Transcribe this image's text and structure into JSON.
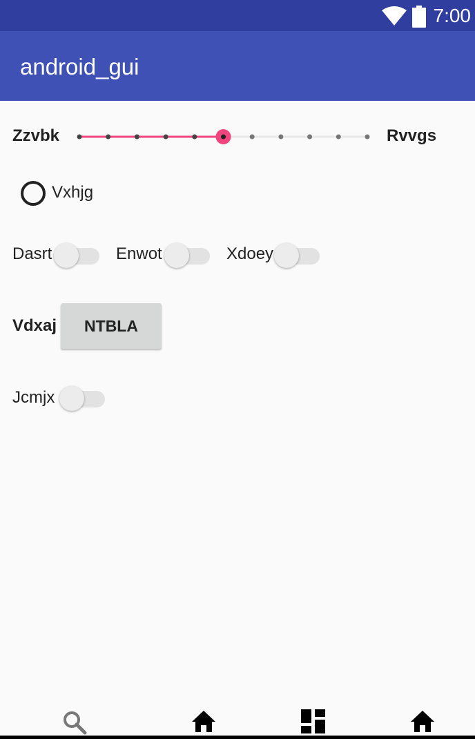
{
  "status_bar": {
    "time": "7:00",
    "icons": [
      "wifi-icon",
      "battery-icon"
    ]
  },
  "app_bar": {
    "title": "android_gui"
  },
  "slider": {
    "min_label": "Zzvbk",
    "max_label": "Rvvgs",
    "steps": 10,
    "value": 5,
    "accent_color": "#f0457e"
  },
  "radio": {
    "label": "Vxhjg",
    "checked": false
  },
  "switch_row": [
    {
      "label": "Dasrt",
      "on": false
    },
    {
      "label": "Enwot",
      "on": false
    },
    {
      "label": "Xdoey",
      "on": false
    }
  ],
  "button_row": {
    "label": "Vdxaj",
    "button_label": "NTBLA"
  },
  "jcmjx_switch": {
    "label": "Jcmjx",
    "on": false
  },
  "bottom_nav": {
    "icons": [
      "search-icon",
      "home-icon",
      "dashboard-icon",
      "home-icon"
    ]
  },
  "colors": {
    "status_bar": "#303f9f",
    "app_bar": "#3f51b5",
    "background": "#fafafa"
  }
}
